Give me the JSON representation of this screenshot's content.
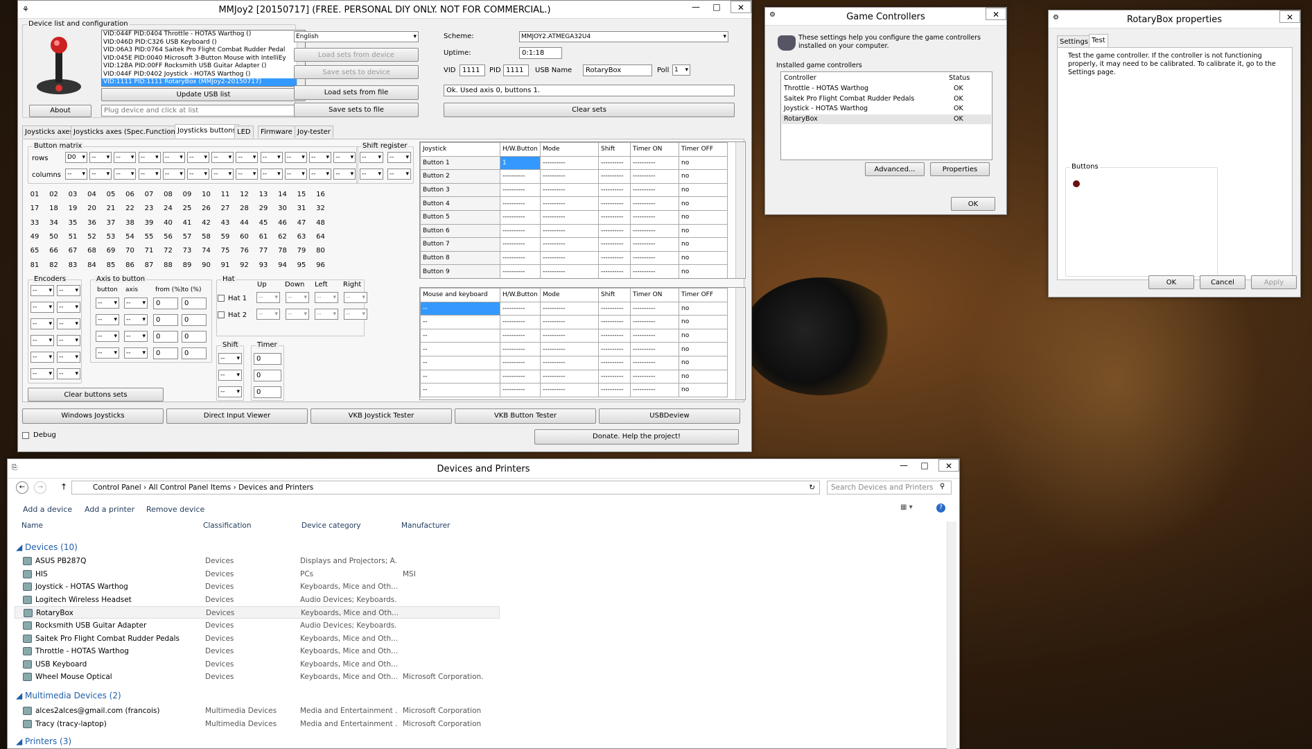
{
  "mmjoy": {
    "title": "MMJoy2 [20150717] (FREE. PERSONAL DIY ONLY. NOT FOR COMMERCIAL.)",
    "device_group": "Device list and configuration",
    "devices": [
      "VID:044F PID:0404 Throttle - HOTAS Warthog ()",
      "VID:046D PID:C326 USB Keyboard ()",
      "VID:06A3 PID:0764 Saitek Pro Flight Combat Rudder Pedal",
      "VID:045E PID:0040 Microsoft 3-Button Mouse with IntelliEy",
      "VID:12BA PID:00FF Rocksmith USB Guitar Adapter ()",
      "VID:044F PID:0402 Joystick - HOTAS Warthog ()",
      "VID:1111 PID:1111 RotaryBox (MMJoy2-20150717)"
    ],
    "about": "About",
    "update_usb": "Update USB list",
    "plug_placeholder": "Plug device and click at list",
    "language": "English",
    "load_sets_device": "Load sets from device",
    "save_sets_device": "Save sets to device",
    "load_sets_file": "Load sets from file",
    "save_sets_file": "Save sets to file",
    "scheme_label": "Scheme:",
    "scheme": "MMJOY2.ATMEGA32U4",
    "uptime_label": "Uptime:",
    "uptime": "0:1:18",
    "vid_label": "VID",
    "vid": "1111",
    "pid_label": "PID",
    "pid": "1111",
    "usbname_label": "USB Name",
    "usbname": "RotaryBox",
    "poll_label": "Poll",
    "poll": "1",
    "status": "Ok. Used axis  0, buttons 1.",
    "clear_sets": "Clear sets",
    "tabs": [
      "Joysticks axes",
      "Joysticks axes (Spec.Functions)",
      "Joysticks buttons",
      "LED",
      "Firmware",
      "Joy-tester"
    ],
    "button_matrix": "Button matrix",
    "rows": "rows",
    "columns": "columns",
    "rows_first": "D0",
    "dash": "--",
    "shift_register": "Shift register",
    "buttons": [
      "01",
      "02",
      "03",
      "04",
      "05",
      "06",
      "07",
      "08",
      "09",
      "10",
      "11",
      "12",
      "13",
      "14",
      "15",
      "16",
      "17",
      "18",
      "19",
      "20",
      "21",
      "22",
      "23",
      "24",
      "25",
      "26",
      "27",
      "28",
      "29",
      "30",
      "31",
      "32",
      "33",
      "34",
      "35",
      "36",
      "37",
      "38",
      "39",
      "40",
      "41",
      "42",
      "43",
      "44",
      "45",
      "46",
      "47",
      "48",
      "49",
      "50",
      "51",
      "52",
      "53",
      "54",
      "55",
      "56",
      "57",
      "58",
      "59",
      "60",
      "61",
      "62",
      "63",
      "64",
      "65",
      "66",
      "67",
      "68",
      "69",
      "70",
      "71",
      "72",
      "73",
      "74",
      "75",
      "76",
      "77",
      "78",
      "79",
      "80",
      "81",
      "82",
      "83",
      "84",
      "85",
      "86",
      "87",
      "88",
      "89",
      "90",
      "91",
      "92",
      "93",
      "94",
      "95",
      "96"
    ],
    "encoders": "Encoders",
    "axis_to_button": "Axis to button",
    "atb_button": "button",
    "atb_axis": "axis",
    "atb_from": "from (%)",
    "atb_to": "to (%)",
    "zero": "0",
    "hat": "Hat",
    "hat_up": "Up",
    "hat_down": "Down",
    "hat_left": "Left",
    "hat_right": "Right",
    "hat1": "Hat 1",
    "hat2": "Hat 2",
    "shift": "Shift",
    "timer": "Timer",
    "clear_buttons": "Clear buttons sets",
    "joy_cols": [
      "Joystick",
      "H/W.Button",
      "Mode",
      "Shift",
      "Timer ON",
      "Timer OFF"
    ],
    "joy_rows": [
      [
        "Button 1",
        "1",
        "----------",
        "----------",
        "----------",
        "no"
      ],
      [
        "Button 2",
        "----------",
        "----------",
        "----------",
        "----------",
        "no"
      ],
      [
        "Button 3",
        "----------",
        "----------",
        "----------",
        "----------",
        "no"
      ],
      [
        "Button 4",
        "----------",
        "----------",
        "----------",
        "----------",
        "no"
      ],
      [
        "Button 5",
        "----------",
        "----------",
        "----------",
        "----------",
        "no"
      ],
      [
        "Button 6",
        "----------",
        "----------",
        "----------",
        "----------",
        "no"
      ],
      [
        "Button 7",
        "----------",
        "----------",
        "----------",
        "----------",
        "no"
      ],
      [
        "Button 8",
        "----------",
        "----------",
        "----------",
        "----------",
        "no"
      ],
      [
        "Button 9",
        "----------",
        "----------",
        "----------",
        "----------",
        "no"
      ]
    ],
    "mk_cols": [
      "Mouse and keyboard",
      "H/W.Button",
      "Mode",
      "Shift",
      "Timer ON",
      "Timer OFF"
    ],
    "mk_rows": [
      [
        "--",
        "----------",
        "----------",
        "----------",
        "----------",
        "no"
      ],
      [
        "--",
        "----------",
        "----------",
        "----------",
        "----------",
        "no"
      ],
      [
        "--",
        "----------",
        "----------",
        "----------",
        "----------",
        "no"
      ],
      [
        "--",
        "----------",
        "----------",
        "----------",
        "----------",
        "no"
      ],
      [
        "--",
        "----------",
        "----------",
        "----------",
        "----------",
        "no"
      ],
      [
        "--",
        "----------",
        "----------",
        "----------",
        "----------",
        "no"
      ],
      [
        "--",
        "----------",
        "----------",
        "----------",
        "----------",
        "no"
      ]
    ],
    "bottom_buttons": [
      "Windows Joysticks",
      "Direct Input Viewer",
      "VKB Joystick Tester",
      "VKB Button Tester",
      "USBDeview"
    ],
    "debug": "Debug",
    "donate": "Donate. Help the project!"
  },
  "game_controllers": {
    "title": "Game Controllers",
    "intro": "These settings help you configure the game controllers installed on your computer.",
    "installed": "Installed game controllers",
    "col_controller": "Controller",
    "col_status": "Status",
    "rows": [
      [
        "Throttle - HOTAS Warthog",
        "OK"
      ],
      [
        "Saitek Pro Flight Combat Rudder Pedals",
        "OK"
      ],
      [
        "Joystick - HOTAS Warthog",
        "OK"
      ],
      [
        "RotaryBox",
        "OK"
      ]
    ],
    "advanced": "Advanced...",
    "properties": "Properties",
    "ok": "OK"
  },
  "rotary": {
    "title": "RotaryBox properties",
    "tabs": [
      "Settings",
      "Test"
    ],
    "text": "Test the game controller.  If the controller is not functioning properly, it may need to be calibrated.  To calibrate it, go to the Settings page.",
    "buttons_label": "Buttons",
    "ok": "OK",
    "cancel": "Cancel",
    "apply": "Apply"
  },
  "devices_printers": {
    "title": "Devices and Printers",
    "breadcrumb": [
      "Control Panel",
      "All Control Panel Items",
      "Devices and Printers"
    ],
    "search_placeholder": "Search Devices and Printers",
    "toolbar": [
      "Add a device",
      "Add a printer",
      "Remove device"
    ],
    "cols": [
      "Name",
      "Classification",
      "Device category",
      "Manufacturer"
    ],
    "devices_group": "Devices (10)",
    "devices": [
      [
        "ASUS PB287Q",
        "Devices",
        "Displays and Projectors; A...",
        ""
      ],
      [
        "HIS",
        "Devices",
        "PCs",
        "MSI"
      ],
      [
        "Joystick - HOTAS Warthog",
        "Devices",
        "Keyboards, Mice and Oth...",
        ""
      ],
      [
        "Logitech Wireless Headset",
        "Devices",
        "Audio Devices; Keyboards...",
        ""
      ],
      [
        "RotaryBox",
        "Devices",
        "Keyboards, Mice and Oth...",
        ""
      ],
      [
        "Rocksmith USB Guitar Adapter",
        "Devices",
        "Audio Devices; Keyboards...",
        ""
      ],
      [
        "Saitek Pro Flight Combat Rudder Pedals",
        "Devices",
        "Keyboards, Mice and Oth...",
        ""
      ],
      [
        "Throttle - HOTAS Warthog",
        "Devices",
        "Keyboards, Mice and Oth...",
        ""
      ],
      [
        "USB Keyboard",
        "Devices",
        "Keyboards, Mice and Oth...",
        ""
      ],
      [
        "Wheel Mouse Optical",
        "Devices",
        "Keyboards, Mice and Oth...",
        "Microsoft Corporation."
      ]
    ],
    "multimedia_group": "Multimedia Devices (2)",
    "multimedia": [
      [
        "alces2alces@gmail.com (francois)",
        "Multimedia Devices",
        "Media and Entertainment ...",
        "Microsoft Corporation"
      ],
      [
        "Tracy (tracy-laptop)",
        "Multimedia Devices",
        "Media and Entertainment ...",
        "Microsoft Corporation"
      ]
    ],
    "printers_group": "Printers (3)"
  }
}
